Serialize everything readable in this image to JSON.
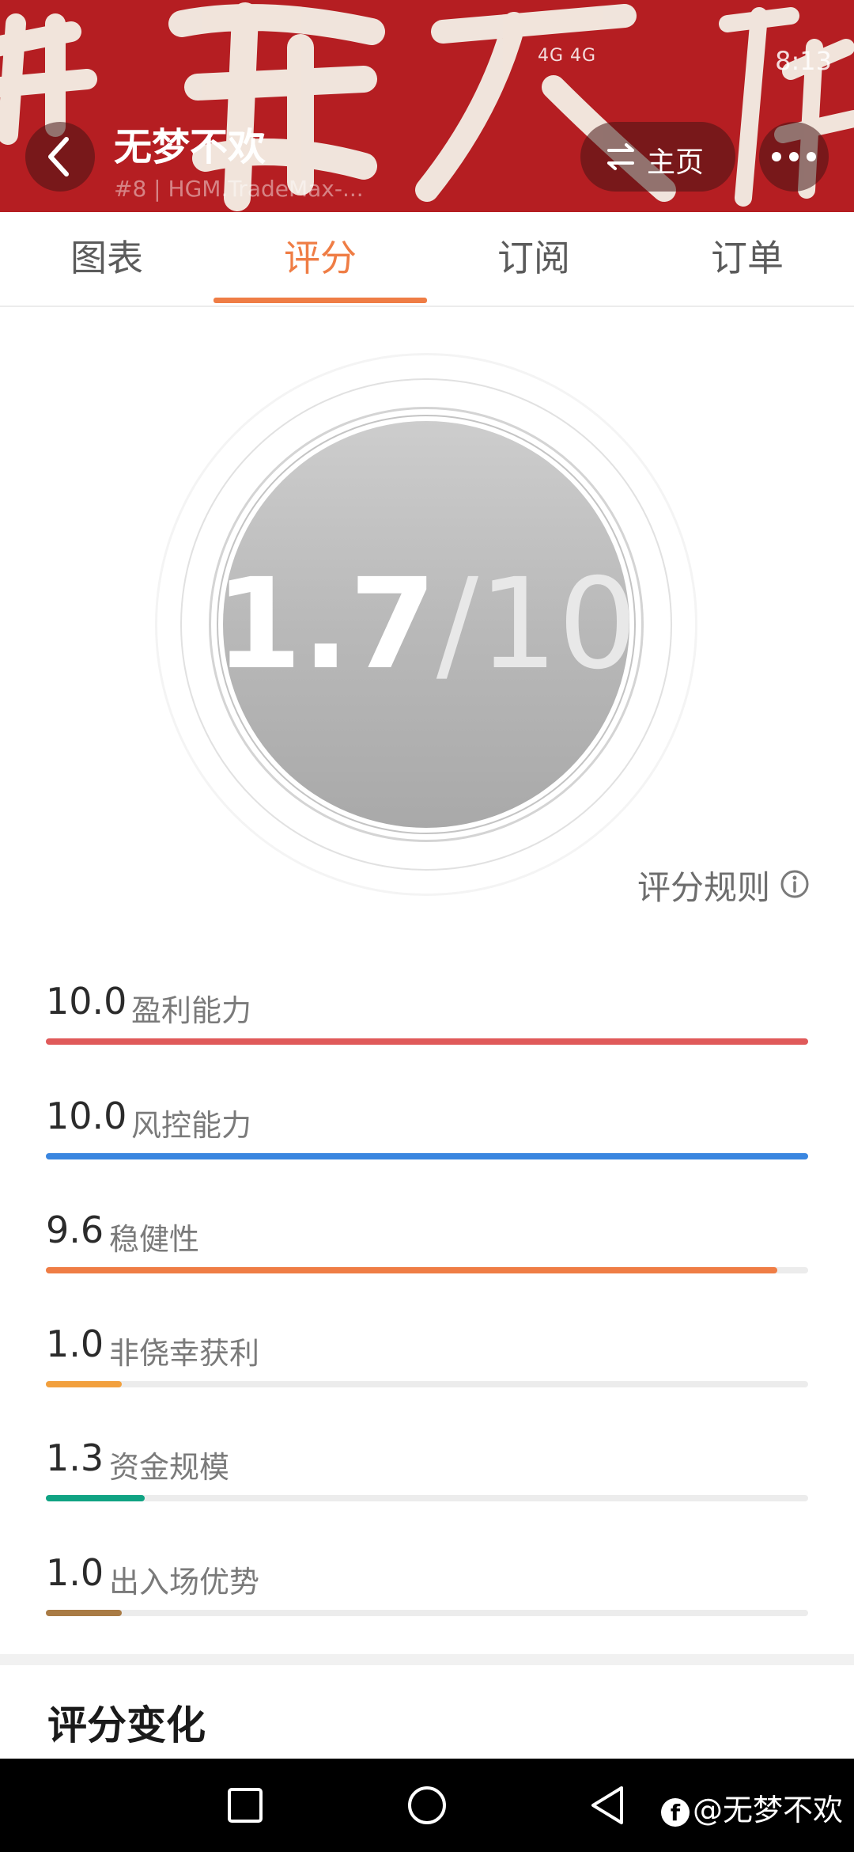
{
  "header": {
    "banner_color": "#b51e22",
    "title": "无梦不欢",
    "subtitle": "#8 | HGM.TradeMax-...",
    "status_signal": "4G 4G",
    "status_time": "8:13",
    "back_icon": "chevron-left-icon",
    "home_label": "主页",
    "home_icon": "swap-icon",
    "more_icon": "more-dots-icon"
  },
  "tabs": [
    {
      "label": "图表",
      "active": false
    },
    {
      "label": "评分",
      "active": true
    },
    {
      "label": "订阅",
      "active": false
    },
    {
      "label": "订单",
      "active": false
    }
  ],
  "accent_color": "#ef7d45",
  "score": {
    "value": "1.7",
    "slash": "/",
    "max": "10"
  },
  "rules_link": {
    "label": "评分规则",
    "icon": "info-icon"
  },
  "metrics": [
    {
      "value": "10.0",
      "label": "盈利能力",
      "fraction": 1.0,
      "color": "#e05a5a"
    },
    {
      "value": "10.0",
      "label": "风控能力",
      "fraction": 1.0,
      "color": "#3a86e0"
    },
    {
      "value": "9.6",
      "label": "稳健性",
      "fraction": 0.96,
      "color": "#ef7d45"
    },
    {
      "value": "1.0",
      "label": "非侥幸获利",
      "fraction": 0.1,
      "color": "#f2a03d"
    },
    {
      "value": "1.3",
      "label": "资金规模",
      "fraction": 0.13,
      "color": "#10a383"
    },
    {
      "value": "1.0",
      "label": "出入场优势",
      "fraction": 0.1,
      "color": "#a97b45"
    }
  ],
  "section_title": "评分变化",
  "system_nav": {
    "square_icon": "recents-square-icon",
    "circle_icon": "home-circle-icon",
    "triangle_icon": "back-triangle-icon",
    "watermark": "@无梦不欢"
  }
}
